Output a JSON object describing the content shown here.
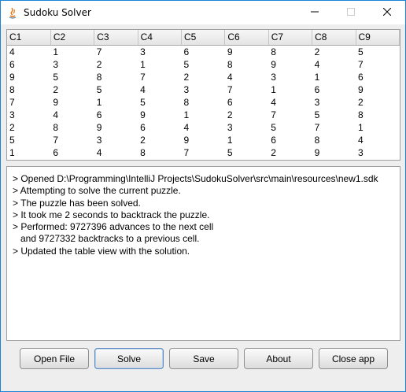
{
  "window": {
    "title": "Sudoku Solver",
    "minimize": "—",
    "maximize": "☐",
    "close": "✕"
  },
  "table": {
    "headers": [
      "C1",
      "C2",
      "C3",
      "C4",
      "C5",
      "C6",
      "C7",
      "C8",
      "C9"
    ],
    "rows": [
      [
        "4",
        "1",
        "7",
        "3",
        "6",
        "9",
        "8",
        "2",
        "5"
      ],
      [
        "6",
        "3",
        "2",
        "1",
        "5",
        "8",
        "9",
        "4",
        "7"
      ],
      [
        "9",
        "5",
        "8",
        "7",
        "2",
        "4",
        "3",
        "1",
        "6"
      ],
      [
        "8",
        "2",
        "5",
        "4",
        "3",
        "7",
        "1",
        "6",
        "9"
      ],
      [
        "7",
        "9",
        "1",
        "5",
        "8",
        "6",
        "4",
        "3",
        "2"
      ],
      [
        "3",
        "4",
        "6",
        "9",
        "1",
        "2",
        "7",
        "5",
        "8"
      ],
      [
        "2",
        "8",
        "9",
        "6",
        "4",
        "3",
        "5",
        "7",
        "1"
      ],
      [
        "5",
        "7",
        "3",
        "2",
        "9",
        "1",
        "6",
        "8",
        "4"
      ],
      [
        "1",
        "6",
        "4",
        "8",
        "7",
        "5",
        "2",
        "9",
        "3"
      ]
    ]
  },
  "log": {
    "lines": [
      "> Opened D:\\Programming\\IntelliJ Projects\\SudokuSolver\\src\\main\\resources\\new1.sdk",
      "> Attempting to solve the current puzzle.",
      "> The puzzle has been solved.",
      "> It took me 2 seconds to backtrack the puzzle.",
      "> Performed: 9727396 advances to the next cell",
      "   and 9727332 backtracks to a previous cell.",
      "> Updated the table view with the solution."
    ]
  },
  "buttons": {
    "open_file": "Open File",
    "solve": "Solve",
    "save": "Save",
    "about": "About",
    "close_app": "Close app"
  }
}
